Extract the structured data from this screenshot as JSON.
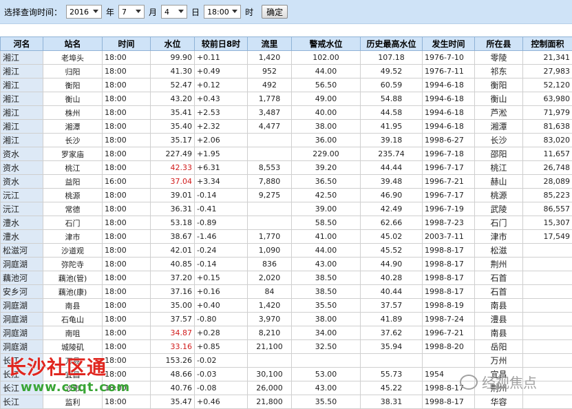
{
  "query": {
    "label": "选择查询时间：",
    "year": "2016",
    "year_unit": "年",
    "month": "7",
    "month_unit": "月",
    "day": "4",
    "day_unit": "日",
    "time": "18:00",
    "time_unit": "时",
    "confirm": "确定"
  },
  "table": {
    "headers": [
      "河名",
      "站名",
      "时间",
      "水位",
      "较前日8时",
      "流里",
      "警戒水位",
      "历史最高水位",
      "发生时间",
      "所在县",
      "控制面积"
    ],
    "rows": [
      [
        "湘江",
        "老埠头",
        "18:00",
        "99.90",
        "+0.11",
        "1,420",
        "102.00",
        "107.18",
        "1976-7-10",
        "零陵",
        "21,341"
      ],
      [
        "湘江",
        "归阳",
        "18:00",
        "41.30",
        "+0.49",
        "952",
        "44.00",
        "49.52",
        "1976-7-11",
        "祁东",
        "27,983"
      ],
      [
        "湘江",
        "衡阳",
        "18:00",
        "52.47",
        "+0.12",
        "492",
        "56.50",
        "60.59",
        "1994-6-18",
        "衡阳",
        "52,120"
      ],
      [
        "湘江",
        "衡山",
        "18:00",
        "43.20",
        "+0.43",
        "1,778",
        "49.00",
        "54.88",
        "1994-6-18",
        "衡山",
        "63,980"
      ],
      [
        "湘江",
        "株州",
        "18:00",
        "35.41",
        "+2.53",
        "3,487",
        "40.00",
        "44.58",
        "1994-6-18",
        "芦淞",
        "71,979"
      ],
      [
        "湘江",
        "湘潭",
        "18:00",
        "35.40",
        "+2.32",
        "4,477",
        "38.00",
        "41.95",
        "1994-6-18",
        "湘潭",
        "81,638"
      ],
      [
        "湘江",
        "长沙",
        "18:00",
        "35.17",
        "+2.06",
        "",
        "36.00",
        "39.18",
        "1998-6-27",
        "长沙",
        "83,020"
      ],
      [
        "资水",
        "罗家庙",
        "18:00",
        "227.49",
        "+1.95",
        "",
        "229.00",
        "235.74",
        "1996-7-18",
        "邵阳",
        "11,657"
      ],
      [
        "资水",
        "桃江",
        "18:00",
        "42.33",
        "+6.31",
        "8,553",
        "39.20",
        "44.44",
        "1996-7-17",
        "桃江",
        "26,748"
      ],
      [
        "资水",
        "益阳",
        "16:00",
        "37.04",
        "+3.34",
        "7,880",
        "36.50",
        "39.48",
        "1996-7-21",
        "赫山",
        "28,089"
      ],
      [
        "沅江",
        "桃源",
        "18:00",
        "39.01",
        "-0.14",
        "9,275",
        "42.50",
        "46.90",
        "1996-7-17",
        "桃源",
        "85,223"
      ],
      [
        "沅江",
        "常德",
        "18:00",
        "36.31",
        "-0.41",
        "",
        "39.00",
        "42.49",
        "1996-7-19",
        "武陵",
        "86,557"
      ],
      [
        "澧水",
        "石门",
        "18:00",
        "53.18",
        "-0.89",
        "",
        "58.50",
        "62.66",
        "1998-7-23",
        "石门",
        "15,307"
      ],
      [
        "澧水",
        "津市",
        "18:00",
        "38.67",
        "-1.46",
        "1,770",
        "41.00",
        "45.02",
        "2003-7-11",
        "津市",
        "17,549"
      ],
      [
        "松滋河",
        "沙道观",
        "18:00",
        "42.01",
        "-0.24",
        "1,090",
        "44.00",
        "45.52",
        "1998-8-17",
        "松滋",
        ""
      ],
      [
        "洞庭湖",
        "弥陀寺",
        "18:00",
        "40.85",
        "-0.14",
        "836",
        "43.00",
        "44.90",
        "1998-8-17",
        "荆州",
        ""
      ],
      [
        "藕池河",
        "藕池(管)",
        "18:00",
        "37.20",
        "+0.15",
        "2,020",
        "38.50",
        "40.28",
        "1998-8-17",
        "石首",
        ""
      ],
      [
        "安乡河",
        "藕池(康)",
        "18:00",
        "37.16",
        "+0.16",
        "84",
        "38.50",
        "40.44",
        "1998-8-17",
        "石首",
        ""
      ],
      [
        "洞庭湖",
        "南县",
        "18:00",
        "35.00",
        "+0.40",
        "1,420",
        "35.50",
        "37.57",
        "1998-8-19",
        "南县",
        ""
      ],
      [
        "洞庭湖",
        "石龟山",
        "18:00",
        "37.57",
        "-0.80",
        "3,970",
        "38.00",
        "41.89",
        "1998-7-24",
        "澧县",
        ""
      ],
      [
        "洞庭湖",
        "南咀",
        "18:00",
        "34.87",
        "+0.28",
        "8,210",
        "34.00",
        "37.62",
        "1996-7-21",
        "南县",
        ""
      ],
      [
        "洞庭湖",
        "城陵矶",
        "18:00",
        "33.16",
        "+0.85",
        "21,100",
        "32.50",
        "35.94",
        "1998-8-20",
        "岳阳",
        ""
      ],
      [
        "长江",
        "万县",
        "18:00",
        "153.26",
        "-0.02",
        "",
        "",
        "",
        "",
        "万州",
        ""
      ],
      [
        "长江",
        "宜昌",
        "18:00",
        "48.66",
        "-0.03",
        "30,100",
        "53.00",
        "55.73",
        "1954",
        "宜昌",
        ""
      ],
      [
        "长江",
        "沙市",
        "18:00",
        "40.76",
        "-0.08",
        "26,000",
        "43.00",
        "45.22",
        "1998-8-17",
        "荆州",
        ""
      ],
      [
        "长江",
        "监利",
        "18:00",
        "35.47",
        "+0.46",
        "21,800",
        "35.50",
        "38.31",
        "1998-8-17",
        "华容",
        ""
      ]
    ],
    "red_rows": [
      8,
      9,
      20,
      21
    ]
  },
  "watermark": {
    "site_name": "长沙社区通",
    "site_url": "www.csqt.com",
    "account": "经视焦点"
  },
  "colors": {
    "header_bg": "#cfe3f7",
    "river_bg": "#dde9f6",
    "alert_red": "#d11a1a"
  }
}
